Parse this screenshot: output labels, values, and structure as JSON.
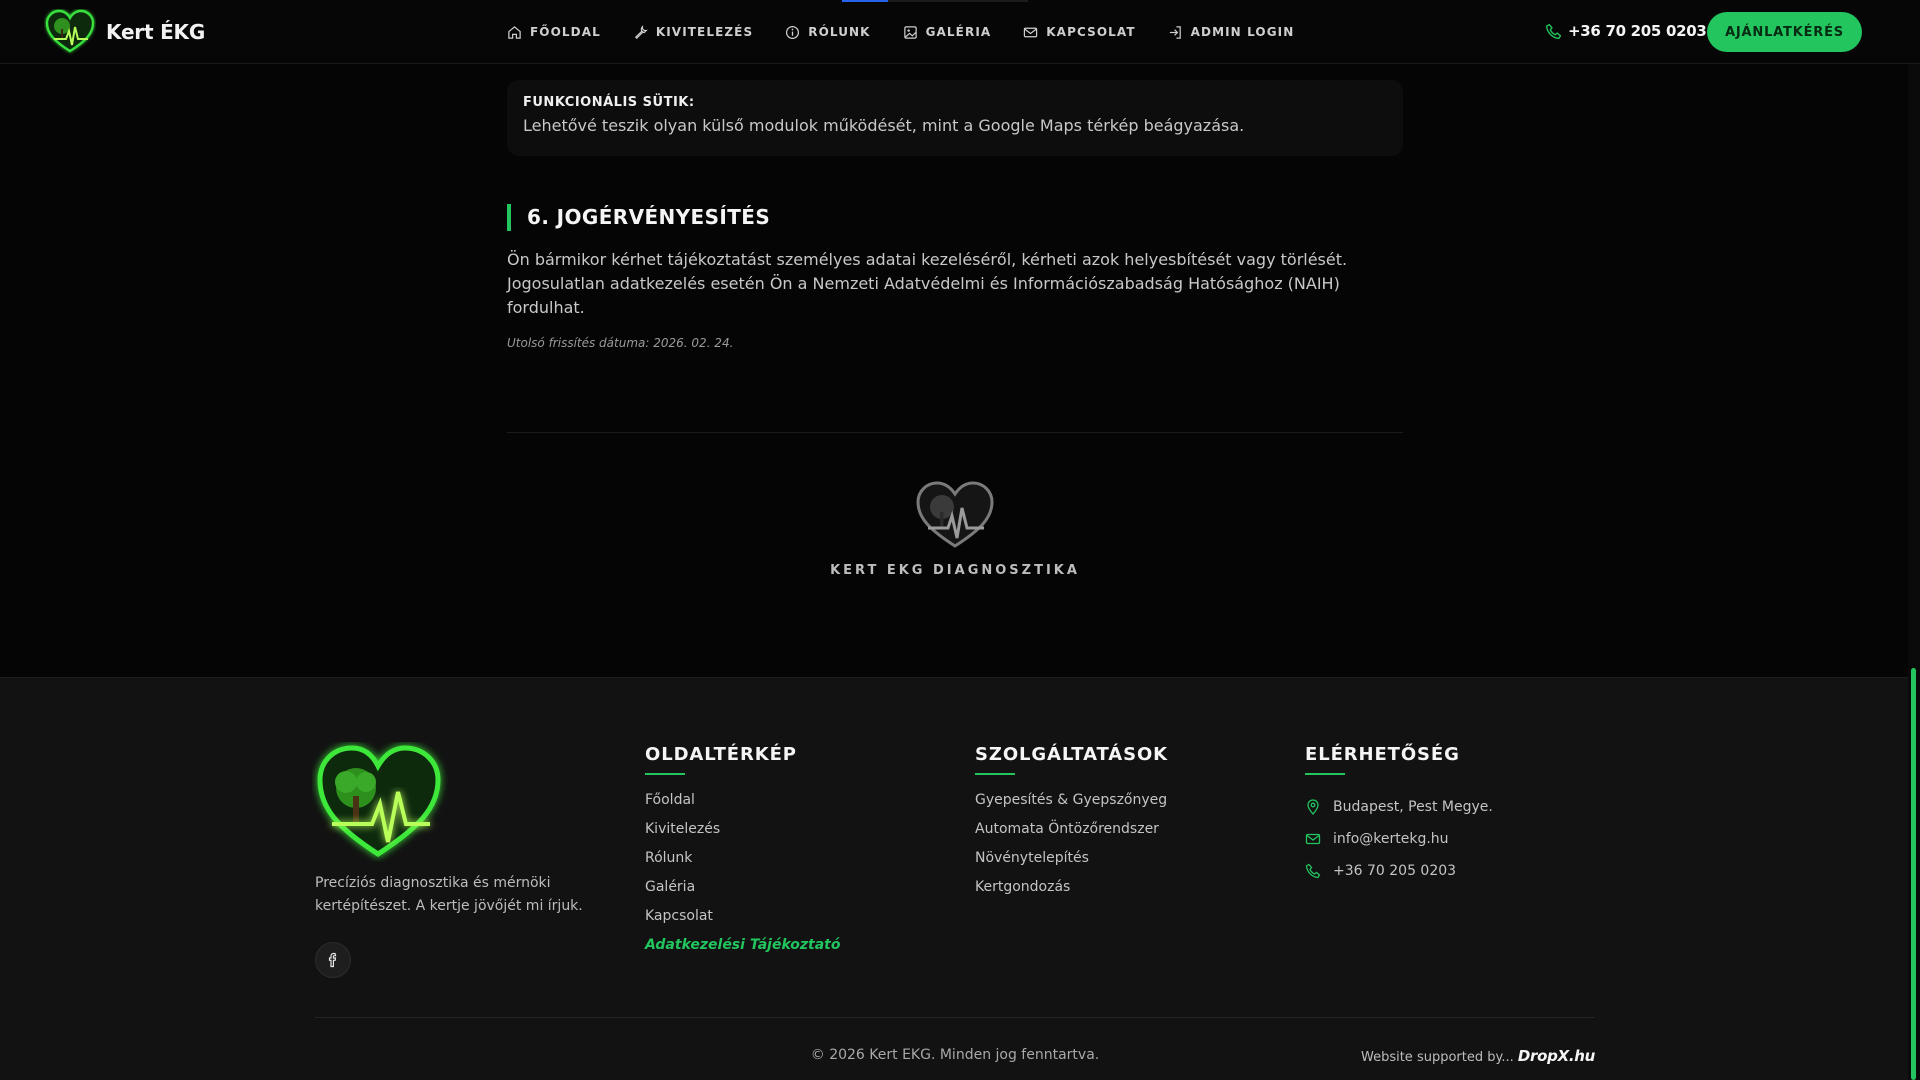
{
  "header": {
    "brand_name": "Kert ÉKG",
    "nav": [
      {
        "label": "FŐOLDAL",
        "icon": "home-icon"
      },
      {
        "label": "KIVITELEZÉS",
        "icon": "wrench-icon"
      },
      {
        "label": "RÓLUNK",
        "icon": "info-icon"
      },
      {
        "label": "GALÉRIA",
        "icon": "image-icon"
      },
      {
        "label": "KAPCSOLAT",
        "icon": "mail-icon"
      },
      {
        "label": "ADMIN LOGIN",
        "icon": "login-icon"
      }
    ],
    "phone": "+36 70 205 0203",
    "cta_label": "AJÁNLATKÉRÉS"
  },
  "content": {
    "cookie_title": "FUNKCIONÁLIS SÜTIK:",
    "cookie_text": "Lehetővé teszik olyan külső modulok működését, mint a Google Maps térkép beágyazása.",
    "section_title": "6. JOGÉRVÉNYESÍTÉS",
    "section_body": "Ön bármikor kérhet tájékoztatást személyes adatai kezeléséről, kérheti azok helyesbítését vagy törlését. Jogosulatlan adatkezelés esetén Ön a Nemzeti Adatvédelmi és Információszabadság Hatósághoz (NAIH) fordulhat.",
    "updated_note": "Utolsó frissítés dátuma: 2026. 02. 24.",
    "center_brand": "KERT EKG DIAGNOSZTIKA"
  },
  "footer": {
    "tagline": "Precíziós diagnosztika és mérnöki kertépítészet. A kertje jövőjét mi írjuk.",
    "sitemap": {
      "title": "OLDALTÉRKÉP",
      "items": [
        "Főoldal",
        "Kivitelezés",
        "Rólunk",
        "Galéria",
        "Kapcsolat",
        "Adatkezelési Tájékoztató"
      ]
    },
    "services": {
      "title": "SZOLGÁLTATÁSOK",
      "items": [
        "Gyepesítés & Gyepszőnyeg",
        "Automata Öntözőrendszer",
        "Növénytelepítés",
        "Kertgondozás"
      ]
    },
    "contact": {
      "title": "ELÉRHETŐSÉG",
      "address": "Budapest, Pest Megye.",
      "email": "info@kertekg.hu",
      "phone": "+36 70 205 0203"
    },
    "copyright": "© 2026 Kert EKG. Minden jog fenntartva.",
    "supported_prefix": "Website supported by...",
    "supported_brand": "DropX.hu"
  },
  "colors": {
    "accent": "#22c55e",
    "background": "#050505",
    "footer_background": "#121212"
  }
}
